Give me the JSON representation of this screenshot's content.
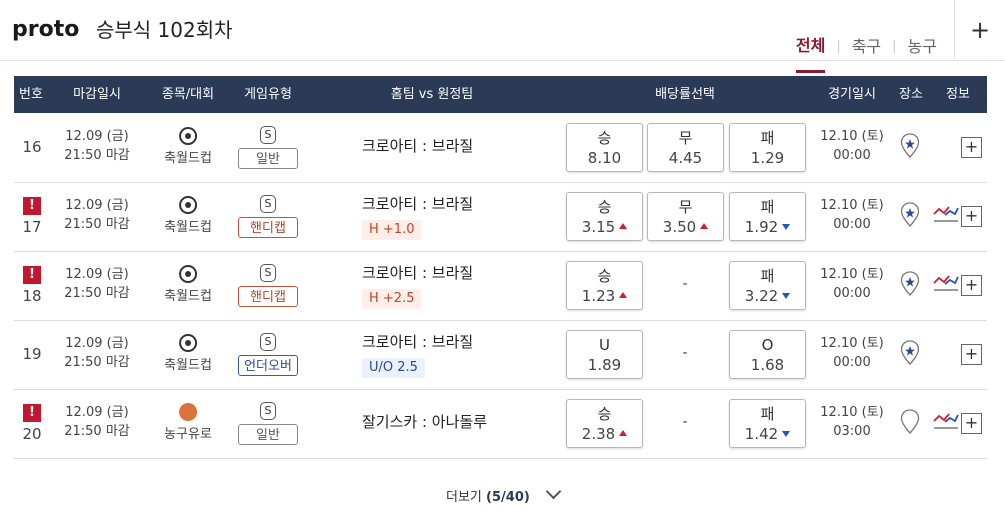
{
  "logo": "proto",
  "page_title": "승부식 102회차",
  "tabs": [
    "전체",
    "축구",
    "농구"
  ],
  "active_tab": "전체",
  "columns": [
    "번호",
    "마감일시",
    "종목/대회",
    "게임유형",
    "홈팀 vs 원정팀",
    "배당률선택",
    "경기일시",
    "장소",
    "정보"
  ],
  "rows": [
    {
      "num": "16",
      "alert": false,
      "close_date": "12.09 (금)",
      "close_time": "21:50 마감",
      "sport": "soccer",
      "league": "축월드컵",
      "type_s": "S",
      "type": "일반",
      "type_kind": "normal",
      "teams": "크로아티 : 브라질",
      "tag": "",
      "tag_kind": "",
      "odds": [
        {
          "label": "승",
          "value": "8.10",
          "trend": ""
        },
        {
          "label": "무",
          "value": "4.45",
          "trend": ""
        },
        {
          "label": "패",
          "value": "1.29",
          "trend": ""
        }
      ],
      "game_date": "12.10 (토)",
      "game_time": "00:00",
      "pin": "starred",
      "chart": false
    },
    {
      "num": "17",
      "alert": true,
      "close_date": "12.09 (금)",
      "close_time": "21:50 마감",
      "sport": "soccer",
      "league": "축월드컵",
      "type_s": "S",
      "type": "핸디캡",
      "type_kind": "handicap",
      "teams": "크로아티 : 브라질",
      "tag": "H +1.0",
      "tag_kind": "h",
      "odds": [
        {
          "label": "승",
          "value": "3.15",
          "trend": "up"
        },
        {
          "label": "무",
          "value": "3.50",
          "trend": "up"
        },
        {
          "label": "패",
          "value": "1.92",
          "trend": "down"
        }
      ],
      "game_date": "12.10 (토)",
      "game_time": "00:00",
      "pin": "starred",
      "chart": true
    },
    {
      "num": "18",
      "alert": true,
      "close_date": "12.09 (금)",
      "close_time": "21:50 마감",
      "sport": "soccer",
      "league": "축월드컵",
      "type_s": "S",
      "type": "핸디캡",
      "type_kind": "handicap",
      "teams": "크로아티 : 브라질",
      "tag": "H +2.5",
      "tag_kind": "h",
      "odds": [
        {
          "label": "승",
          "value": "1.23",
          "trend": "up"
        },
        {
          "label": "",
          "value": "-",
          "trend": ""
        },
        {
          "label": "패",
          "value": "3.22",
          "trend": "down"
        }
      ],
      "game_date": "12.10 (토)",
      "game_time": "00:00",
      "pin": "starred",
      "chart": true
    },
    {
      "num": "19",
      "alert": false,
      "close_date": "12.09 (금)",
      "close_time": "21:50 마감",
      "sport": "soccer",
      "league": "축월드컵",
      "type_s": "S",
      "type": "언더오버",
      "type_kind": "uo",
      "teams": "크로아티 : 브라질",
      "tag": "U/O 2.5",
      "tag_kind": "u",
      "odds": [
        {
          "label": "U",
          "value": "1.89",
          "trend": ""
        },
        {
          "label": "",
          "value": "-",
          "trend": ""
        },
        {
          "label": "O",
          "value": "1.68",
          "trend": ""
        }
      ],
      "game_date": "12.10 (토)",
      "game_time": "00:00",
      "pin": "starred",
      "chart": false
    },
    {
      "num": "20",
      "alert": true,
      "close_date": "12.09 (금)",
      "close_time": "21:50 마감",
      "sport": "basketball",
      "league": "농구유로",
      "type_s": "S",
      "type": "일반",
      "type_kind": "normal",
      "teams": "잘기스카 : 아나돌루",
      "tag": "",
      "tag_kind": "",
      "odds": [
        {
          "label": "승",
          "value": "2.38",
          "trend": "up"
        },
        {
          "label": "",
          "value": "-",
          "trend": ""
        },
        {
          "label": "패",
          "value": "1.42",
          "trend": "down"
        }
      ],
      "game_date": "12.10 (토)",
      "game_time": "03:00",
      "pin": "plain",
      "chart": true
    }
  ],
  "more": {
    "label": "더보기",
    "count": "(5/40)"
  }
}
